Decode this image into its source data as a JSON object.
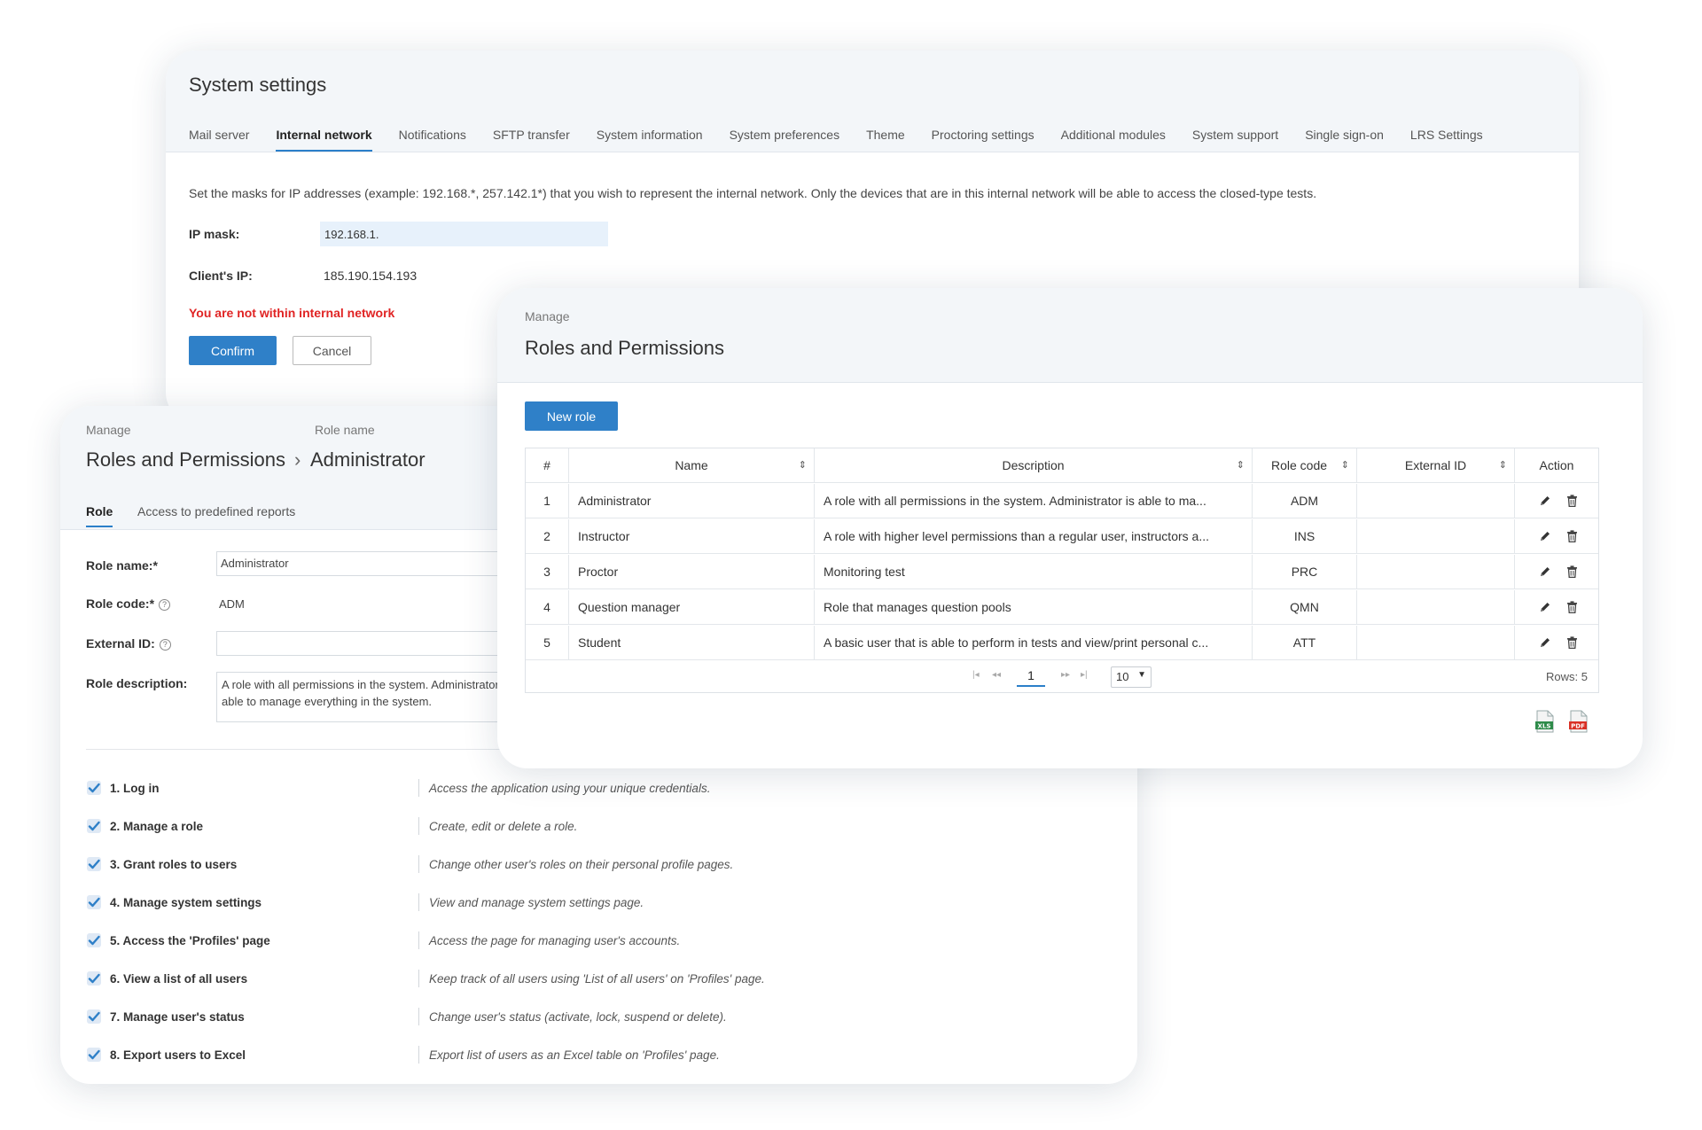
{
  "system_settings": {
    "title": "System settings",
    "tabs": [
      "Mail server",
      "Internal network",
      "Notifications",
      "SFTP transfer",
      "System information",
      "System preferences",
      "Theme",
      "Proctoring settings",
      "Additional modules",
      "System support",
      "Single sign-on",
      "LRS Settings"
    ],
    "active_tab": "Internal network",
    "description": "Set the masks for IP addresses (example: 192.168.*, 257.142.1*) that you wish to represent the internal network. Only the devices that are in this internal network will be able to access the closed-type tests.",
    "ip_mask_label": "IP mask:",
    "ip_mask_value": "192.168.1.",
    "client_ip_label": "Client's IP:",
    "client_ip_value": "185.190.154.193",
    "warning": "You are not within internal network",
    "confirm_label": "Confirm",
    "cancel_label": "Cancel"
  },
  "role_detail": {
    "crumb_small_1": "Manage",
    "crumb_small_2": "Role name",
    "crumb_1": "Roles and Permissions",
    "separator": "›",
    "crumb_2": "Administrator",
    "tabs": [
      "Role",
      "Access to predefined reports"
    ],
    "role_name_label": "Role name:*",
    "role_name_value": "Administrator",
    "role_code_label": "Role code:*",
    "role_code_value": "ADM",
    "external_id_label": "External ID:",
    "external_id_value": "",
    "help_glyph": "?",
    "role_desc_label": "Role description:",
    "role_desc_value": "A role with all permissions in the system. Administrator is able to manage everything in the system.",
    "permissions": [
      {
        "label": "1. Log in",
        "desc": "Access the application using your unique credentials.",
        "checked": true
      },
      {
        "label": "2. Manage a role",
        "desc": "Create, edit or delete a role.",
        "checked": true
      },
      {
        "label": "3. Grant roles to users",
        "desc": "Change other user's roles on their personal profile pages.",
        "checked": true
      },
      {
        "label": "4. Manage system settings",
        "desc": "View and manage system settings page.",
        "checked": true
      },
      {
        "label": "5. Access the 'Profiles' page",
        "desc": "Access the page for managing user's accounts.",
        "checked": true
      },
      {
        "label": "6. View a list of all users",
        "desc": "Keep track of all users using 'List of all users' on 'Profiles' page.",
        "checked": true
      },
      {
        "label": "7. Manage user's status",
        "desc": "Change user's status (activate, lock, suspend or delete).",
        "checked": true
      },
      {
        "label": "8. Export users to Excel",
        "desc": "Export list of users as an Excel table on 'Profiles' page.",
        "checked": true
      }
    ]
  },
  "roles_list": {
    "manage": "Manage",
    "title": "Roles and Permissions",
    "new_role_label": "New role",
    "columns": [
      "#",
      "Name",
      "Description",
      "Role code",
      "External ID",
      "Action"
    ],
    "rows": [
      {
        "n": "1",
        "name": "Administrator",
        "desc": "A role with all permissions in the system. Administrator is able to ma...",
        "code": "ADM",
        "ext": ""
      },
      {
        "n": "2",
        "name": "Instructor",
        "desc": "A role with higher level permissions than a regular user, instructors a...",
        "code": "INS",
        "ext": ""
      },
      {
        "n": "3",
        "name": "Proctor",
        "desc": "Monitoring test",
        "code": "PRC",
        "ext": ""
      },
      {
        "n": "4",
        "name": "Question manager",
        "desc": "Role that manages question pools",
        "code": "QMN",
        "ext": ""
      },
      {
        "n": "5",
        "name": "Student",
        "desc": "A basic user that is able to perform in tests and view/print personal c...",
        "code": "ATT",
        "ext": ""
      }
    ],
    "page_current": "1",
    "page_size": "10",
    "rows_count": "Rows: 5",
    "export_xls_label": "XLS",
    "export_pdf_label": "PDF"
  },
  "colors": {
    "accent": "#2f80c8",
    "warning": "#e02424",
    "header_bg": "#f3f6f9"
  }
}
